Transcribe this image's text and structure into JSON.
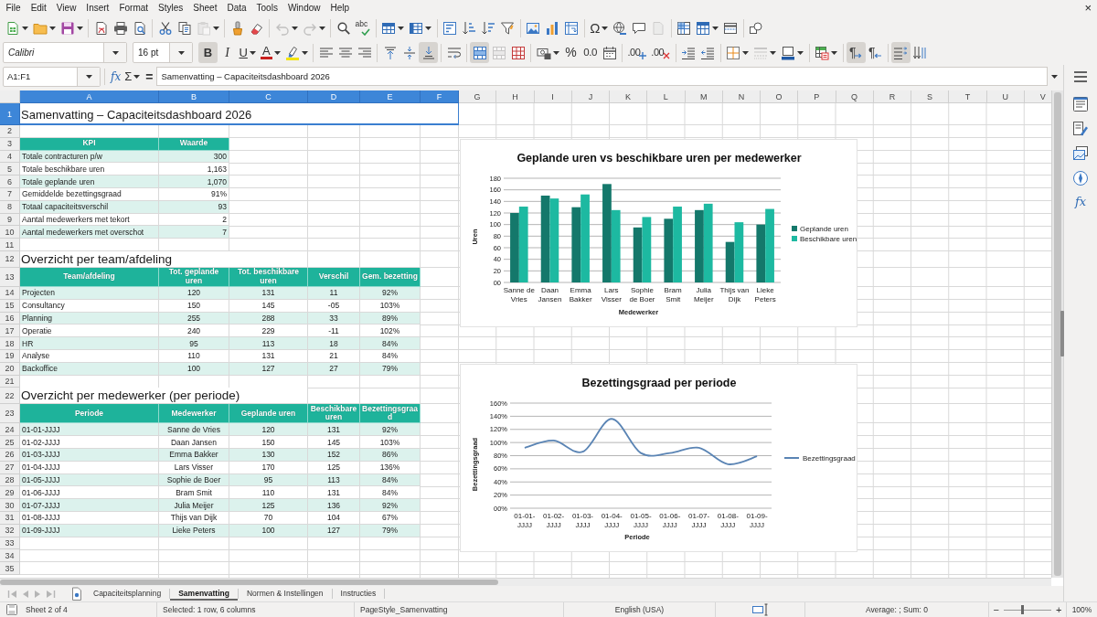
{
  "menu_bar": {
    "items": [
      "File",
      "Edit",
      "View",
      "Insert",
      "Format",
      "Styles",
      "Sheet",
      "Data",
      "Tools",
      "Window",
      "Help"
    ],
    "close": "×"
  },
  "standard_toolbar": {
    "paste": {
      "disabled": true
    },
    "undo": {
      "disabled": true
    },
    "redo": {
      "disabled": true
    },
    "spelling": {
      "label": "abc"
    },
    "special_character": {
      "label": "Ω"
    },
    "headers_footers": {
      "disabled": true
    }
  },
  "formatting_toolbar": {
    "font_name": "Calibri",
    "font_size": "16 pt",
    "bold": {
      "label": "B",
      "on": true
    },
    "italic": {
      "label": "I",
      "on": false
    },
    "underline": {
      "label": "U",
      "on": false
    },
    "font_color": {
      "label": "A"
    },
    "align_top": {
      "on": false
    },
    "align_middle": {
      "on": false
    },
    "align_bottom": {
      "on": true
    },
    "merge_center": {
      "on": true
    },
    "merge_cells": {
      "disabled": true
    },
    "percent": {
      "label": "%"
    },
    "number": {
      "label": "0.0"
    },
    "add_decimal": {
      "label": ".00"
    },
    "delete_decimal": {
      "label": ".00"
    },
    "border_style": {
      "disabled": true
    },
    "left_to_right": {
      "label": "¶",
      "on": true
    },
    "right_to_left": {
      "label": "¶",
      "on": false
    },
    "text_horizontal": {
      "on": true
    },
    "text_vertical": {
      "on": false
    }
  },
  "formula_bar": {
    "name_box": "A1:F1",
    "function_wizard": "fx",
    "sum": "Σ",
    "formula": "=",
    "content": "Samenvatting – Capaciteitsdashboard 2026"
  },
  "sidebar": {
    "functions": "fx"
  },
  "sheet": {
    "columns": [
      {
        "label": "A",
        "selected": true
      },
      {
        "label": "B",
        "selected": true
      },
      {
        "label": "C",
        "selected": true
      },
      {
        "label": "D",
        "selected": true
      },
      {
        "label": "E",
        "selected": true
      },
      {
        "label": "F",
        "selected": true
      },
      {
        "label": "G",
        "selected": false
      },
      {
        "label": "H",
        "selected": false
      },
      {
        "label": "I",
        "selected": false
      },
      {
        "label": "J",
        "selected": false
      },
      {
        "label": "K",
        "selected": false
      },
      {
        "label": "L",
        "selected": false
      },
      {
        "label": "M",
        "selected": false
      },
      {
        "label": "N",
        "selected": false
      },
      {
        "label": "O",
        "selected": false
      },
      {
        "label": "P",
        "selected": false
      },
      {
        "label": "Q",
        "selected": false
      },
      {
        "label": "R",
        "selected": false
      },
      {
        "label": "S",
        "selected": false
      },
      {
        "label": "T",
        "selected": false
      },
      {
        "label": "U",
        "selected": false
      },
      {
        "label": "V",
        "selected": false
      }
    ],
    "rows": [
      {
        "number": "1",
        "selected": true,
        "kind": "title",
        "cells": [
          "Samenvatting – Capaciteitsdashboard 2026"
        ]
      },
      {
        "number": "2",
        "selected": false,
        "kind": "empty"
      },
      {
        "number": "3",
        "selected": false,
        "kind": "header",
        "cells": [
          "KPI",
          "Waarde"
        ]
      },
      {
        "number": "4",
        "selected": false,
        "kind": "kpi",
        "shaded": true,
        "cells": [
          "Totale contracturen p/w",
          "300"
        ]
      },
      {
        "number": "5",
        "selected": false,
        "kind": "kpi",
        "shaded": false,
        "cells": [
          "Totale beschikbare uren",
          "1,163"
        ]
      },
      {
        "number": "6",
        "selected": false,
        "kind": "kpi",
        "shaded": true,
        "cells": [
          "Totale geplande uren",
          "1,070"
        ]
      },
      {
        "number": "7",
        "selected": false,
        "kind": "kpi",
        "shaded": false,
        "cells": [
          "Gemiddelde bezettingsgraad",
          "91%"
        ]
      },
      {
        "number": "8",
        "selected": false,
        "kind": "kpi",
        "shaded": true,
        "cells": [
          "Totaal capaciteitsverschil",
          "93"
        ]
      },
      {
        "number": "9",
        "selected": false,
        "kind": "kpi",
        "shaded": false,
        "cells": [
          "Aantal medewerkers met tekort",
          "2"
        ]
      },
      {
        "number": "10",
        "selected": false,
        "kind": "kpi",
        "shaded": true,
        "cells": [
          "Aantal medewerkers met overschot",
          "7"
        ]
      },
      {
        "number": "11",
        "selected": false,
        "kind": "empty"
      },
      {
        "number": "12",
        "selected": false,
        "kind": "section",
        "cells": [
          "Overzicht per team/afdeling"
        ]
      },
      {
        "number": "13",
        "selected": false,
        "kind": "header",
        "cells": [
          "Team/afdeling",
          "Tot. geplande uren",
          "Tot. beschikbare uren",
          "Verschil",
          "Gem. bezetting"
        ]
      },
      {
        "number": "14",
        "selected": false,
        "kind": "data",
        "shaded": true,
        "cells": [
          "Projecten",
          "120",
          "131",
          "11",
          "92%"
        ]
      },
      {
        "number": "15",
        "selected": false,
        "kind": "data",
        "shaded": false,
        "cells": [
          "Consultancy",
          "150",
          "145",
          "-05",
          "103%"
        ]
      },
      {
        "number": "16",
        "selected": false,
        "kind": "data",
        "shaded": true,
        "cells": [
          "Planning",
          "255",
          "288",
          "33",
          "89%"
        ]
      },
      {
        "number": "17",
        "selected": false,
        "kind": "data",
        "shaded": false,
        "cells": [
          "Operatie",
          "240",
          "229",
          "-11",
          "102%"
        ]
      },
      {
        "number": "18",
        "selected": false,
        "kind": "data",
        "shaded": true,
        "cells": [
          "HR",
          "95",
          "113",
          "18",
          "84%"
        ]
      },
      {
        "number": "19",
        "selected": false,
        "kind": "data",
        "shaded": false,
        "cells": [
          "Analyse",
          "110",
          "131",
          "21",
          "84%"
        ]
      },
      {
        "number": "20",
        "selected": false,
        "kind": "data",
        "shaded": true,
        "cells": [
          "Backoffice",
          "100",
          "127",
          "27",
          "79%"
        ]
      },
      {
        "number": "21",
        "selected": false,
        "kind": "empty"
      },
      {
        "number": "22",
        "selected": false,
        "kind": "section",
        "cells": [
          "Overzicht per medewerker (per periode)"
        ]
      },
      {
        "number": "23",
        "selected": false,
        "kind": "header",
        "cells": [
          "Periode",
          "Medewerker",
          "Geplande uren",
          "Beschikbare uren",
          "Bezettingsgraad"
        ]
      },
      {
        "number": "24",
        "selected": false,
        "kind": "data",
        "shaded": true,
        "cells": [
          "01-01-JJJJ",
          "Sanne de Vries",
          "120",
          "131",
          "92%"
        ]
      },
      {
        "number": "25",
        "selected": false,
        "kind": "data",
        "shaded": false,
        "cells": [
          "01-02-JJJJ",
          "Daan Jansen",
          "150",
          "145",
          "103%"
        ]
      },
      {
        "number": "26",
        "selected": false,
        "kind": "data",
        "shaded": true,
        "cells": [
          "01-03-JJJJ",
          "Emma Bakker",
          "130",
          "152",
          "86%"
        ]
      },
      {
        "number": "27",
        "selected": false,
        "kind": "data",
        "shaded": false,
        "cells": [
          "01-04-JJJJ",
          "Lars Visser",
          "170",
          "125",
          "136%"
        ]
      },
      {
        "number": "28",
        "selected": false,
        "kind": "data",
        "shaded": true,
        "cells": [
          "01-05-JJJJ",
          "Sophie de Boer",
          "95",
          "113",
          "84%"
        ]
      },
      {
        "number": "29",
        "selected": false,
        "kind": "data",
        "shaded": false,
        "cells": [
          "01-06-JJJJ",
          "Bram Smit",
          "110",
          "131",
          "84%"
        ]
      },
      {
        "number": "30",
        "selected": false,
        "kind": "data",
        "shaded": true,
        "cells": [
          "01-07-JJJJ",
          "Julia Meijer",
          "125",
          "136",
          "92%"
        ]
      },
      {
        "number": "31",
        "selected": false,
        "kind": "data",
        "shaded": false,
        "cells": [
          "01-08-JJJJ",
          "Thijs van Dijk",
          "70",
          "104",
          "67%"
        ]
      },
      {
        "number": "32",
        "selected": false,
        "kind": "data",
        "shaded": true,
        "cells": [
          "01-09-JJJJ",
          "Lieke Peters",
          "100",
          "127",
          "79%"
        ]
      },
      {
        "number": "33",
        "selected": false,
        "kind": "empty"
      },
      {
        "number": "34",
        "selected": false,
        "kind": "empty"
      },
      {
        "number": "35",
        "selected": false,
        "kind": "empty"
      }
    ],
    "charts": [
      {
        "chart_data": {
          "type": "bar",
          "title": "Geplande uren vs beschikbare uren per medewerker",
          "xlabel": "Medewerker",
          "ylabel": "Uren",
          "categories": [
            "Sanne de Vries",
            "Daan Jansen",
            "Emma Bakker",
            "Lars Visser",
            "Sophie de Boer",
            "Bram Smit",
            "Julia Meijer",
            "Thijs van Dijk",
            "Lieke Peters"
          ],
          "series": [
            {
              "name": "Geplande uren",
              "color": "#14786b",
              "values": [
                120,
                150,
                130,
                170,
                95,
                110,
                125,
                70,
                100
              ]
            },
            {
              "name": "Beschikbare uren",
              "color": "#1db9a1",
              "values": [
                131,
                145,
                152,
                125,
                113,
                131,
                136,
                104,
                127
              ]
            }
          ],
          "ylim": [
            0,
            180
          ],
          "yticks": [
            {
              "value": 0,
              "label": "00"
            },
            {
              "value": 20,
              "label": "20"
            },
            {
              "value": 40,
              "label": "40"
            },
            {
              "value": 60,
              "label": "60"
            },
            {
              "value": 80,
              "label": "80"
            },
            {
              "value": 100,
              "label": "100"
            },
            {
              "value": 120,
              "label": "120"
            },
            {
              "value": 140,
              "label": "140"
            },
            {
              "value": 160,
              "label": "160"
            },
            {
              "value": 180,
              "label": "180"
            }
          ],
          "grid": true,
          "legend": "right"
        }
      },
      {
        "chart_data": {
          "type": "line",
          "title": "Bezettingsgraad per periode",
          "xlabel": "Periode",
          "ylabel": "Bezettingsgraad",
          "categories": [
            "01-01-JJJJ",
            "01-02-JJJJ",
            "01-03-JJJJ",
            "01-04-JJJJ",
            "01-05-JJJJ",
            "01-06-JJJJ",
            "01-07-JJJJ",
            "01-08-JJJJ",
            "01-09-JJJJ"
          ],
          "series": [
            {
              "name": "Bezettingsgraad",
              "color": "#5a84b4",
              "values": [
                92,
                103,
                86,
                136,
                84,
                84,
                92,
                67,
                79
              ]
            }
          ],
          "ylim": [
            0,
            160
          ],
          "yticks": [
            {
              "value": 0,
              "label": "00%"
            },
            {
              "value": 20,
              "label": "20%"
            },
            {
              "value": 40,
              "label": "40%"
            },
            {
              "value": 60,
              "label": "60%"
            },
            {
              "value": 80,
              "label": "80%"
            },
            {
              "value": 100,
              "label": "100%"
            },
            {
              "value": 120,
              "label": "120%"
            },
            {
              "value": 140,
              "label": "140%"
            },
            {
              "value": 160,
              "label": "160%"
            }
          ],
          "grid": true,
          "legend": "right"
        }
      }
    ]
  },
  "sheet_tabs": [
    {
      "label": "Capaciteitsplanning",
      "selected": false
    },
    {
      "label": "Samenvatting",
      "selected": true
    },
    {
      "label": "Normen & Instellingen",
      "selected": false
    },
    {
      "label": "Instructies",
      "selected": false
    }
  ],
  "status_bar": {
    "sheet_position": "Sheet 2 of 4",
    "selection": "Selected: 1 row, 6 columns",
    "page_style": "PageStyle_Samenvatting",
    "language": "English (USA)",
    "summary": "Average: ; Sum: 0",
    "zoom_out": "−",
    "zoom_slider": {
      "level": 0.4
    },
    "zoom_in": "+",
    "zoom": "100%"
  }
}
